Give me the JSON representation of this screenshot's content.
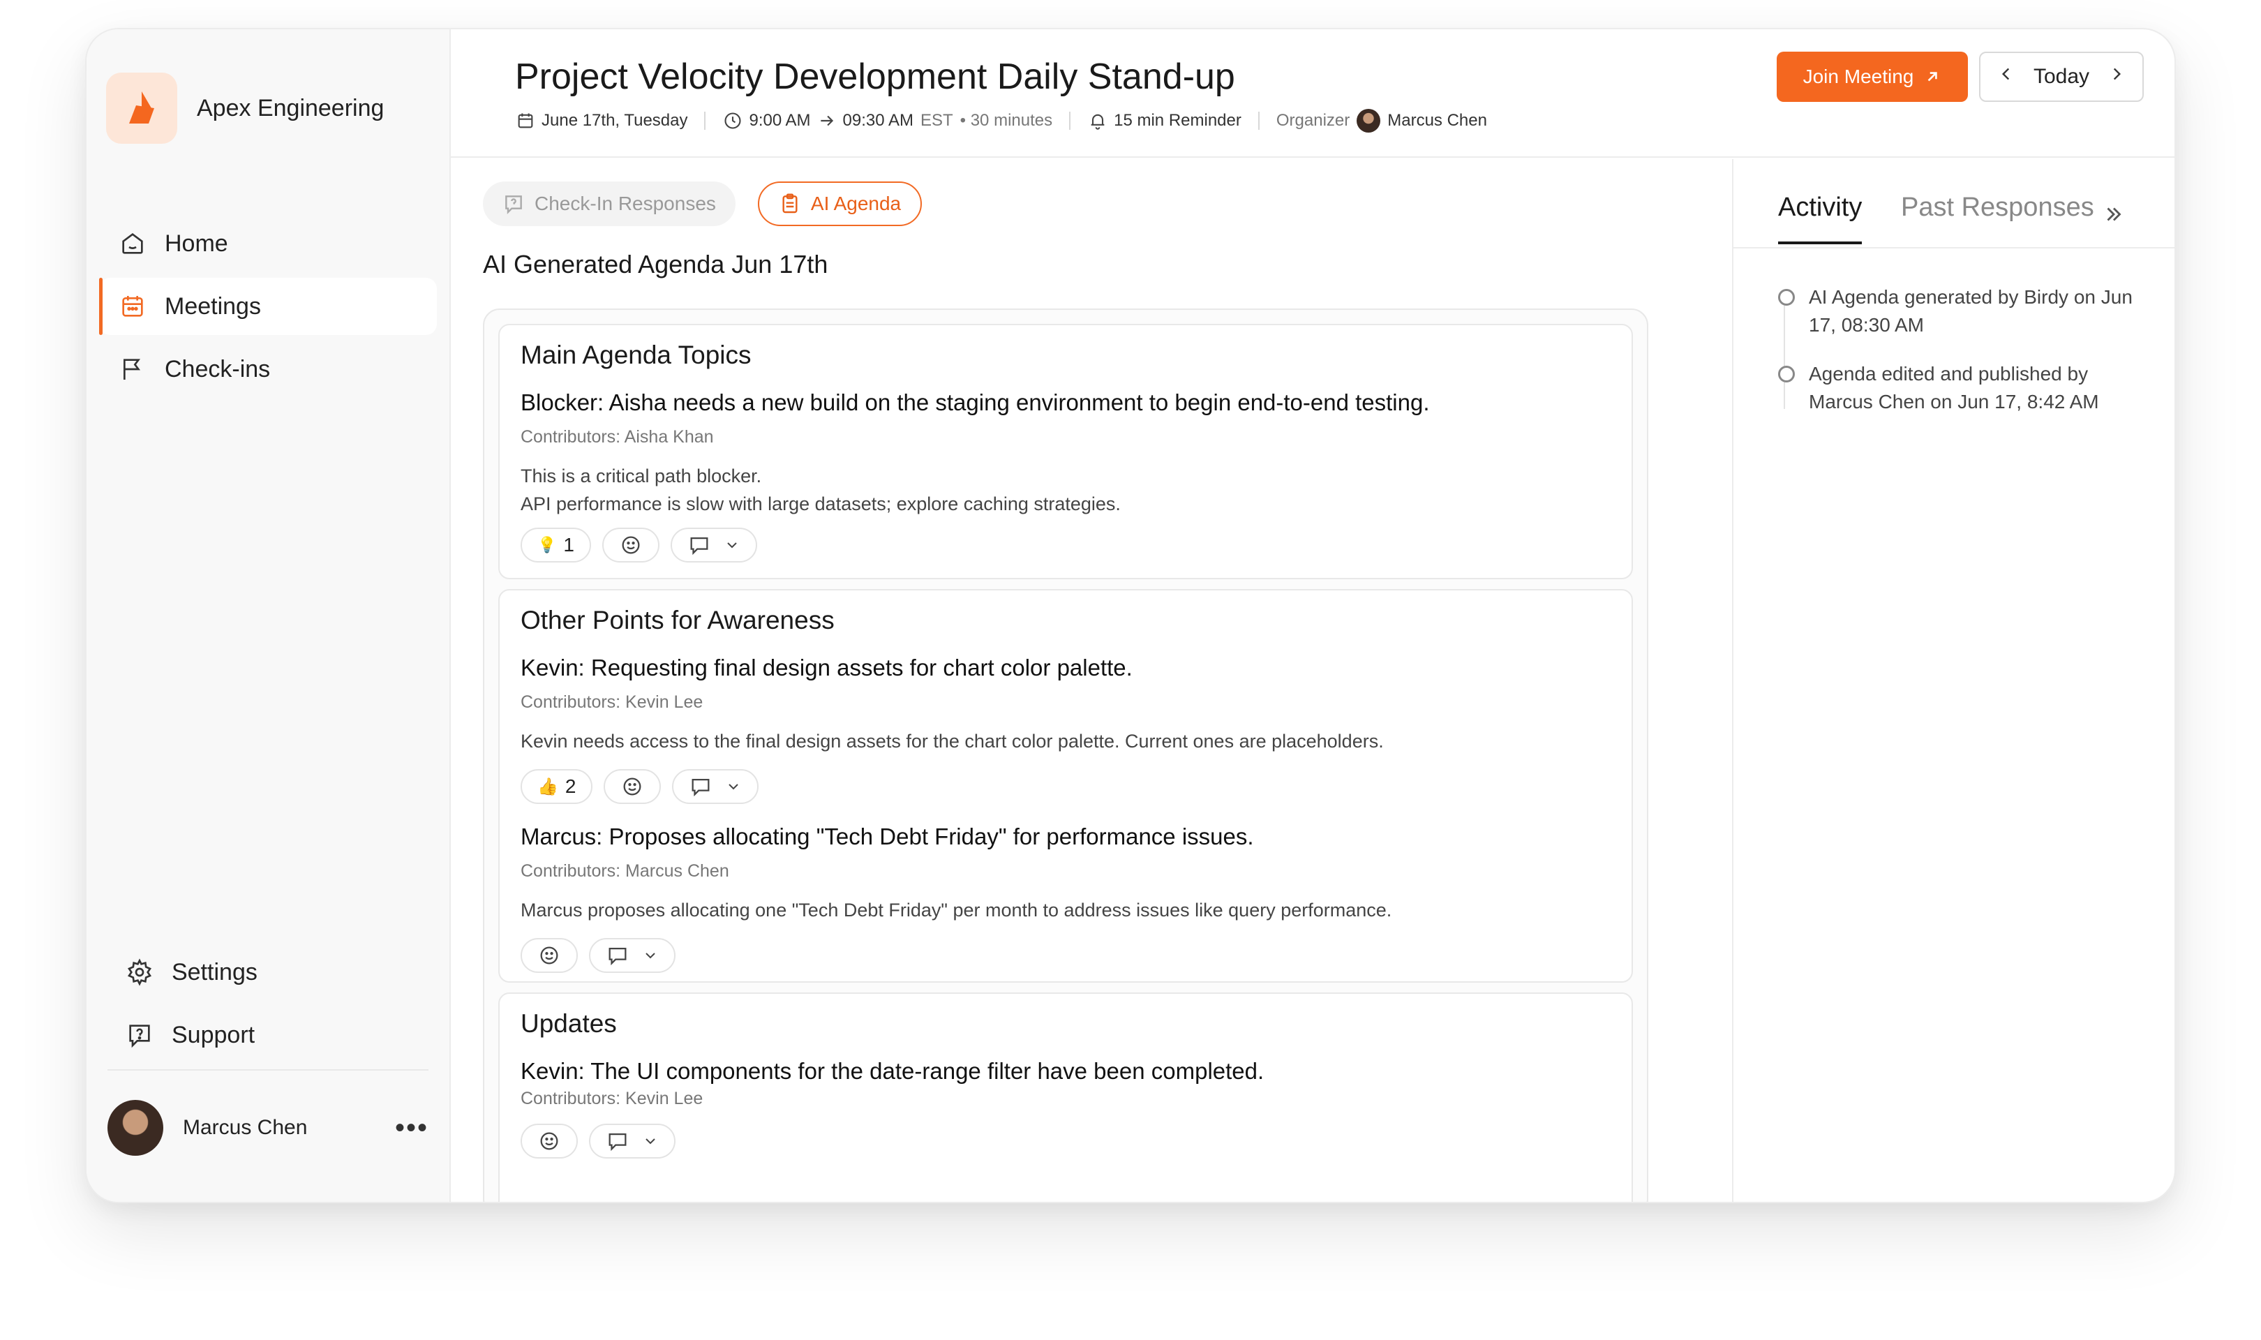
{
  "brand": {
    "name": "Apex Engineering",
    "accent": "#f4671f"
  },
  "nav": {
    "items": [
      {
        "label": "Home",
        "icon": "home-icon"
      },
      {
        "label": "Meetings",
        "icon": "calendar-icon",
        "active": true
      },
      {
        "label": "Check-ins",
        "icon": "flag-icon"
      }
    ],
    "bottom": [
      {
        "label": "Settings",
        "icon": "gear-icon"
      },
      {
        "label": "Support",
        "icon": "help-icon"
      }
    ]
  },
  "user": {
    "name": "Marcus Chen"
  },
  "meeting": {
    "title": "Project Velocity Development Daily Stand-up",
    "date": "June 17th, Tuesday",
    "start": "9:00 AM",
    "end": "09:30 AM",
    "tz": "EST",
    "duration": "• 30 minutes",
    "reminder": "15 min Reminder",
    "organizer_label": "Organizer",
    "organizer": "Marcus Chen"
  },
  "actions": {
    "join": "Join Meeting",
    "today": "Today"
  },
  "tabs": {
    "checkin": "Check-In Responses",
    "agenda": "AI Agenda"
  },
  "agenda": {
    "heading": "AI Generated Agenda  Jun 17th",
    "sections": [
      {
        "title": "Main Agenda Topics",
        "items": [
          {
            "title": "Blocker: Aisha needs a new build on the staging environment to begin end-to-end testing.",
            "contributors": "Contributors: Aisha Khan",
            "desc": [
              "This is a critical path blocker.",
              "API performance is slow with large datasets; explore caching strategies."
            ],
            "reaction": {
              "emoji": "💡",
              "count": "1"
            }
          }
        ]
      },
      {
        "title": "Other Points for Awareness",
        "items": [
          {
            "title": "Kevin: Requesting final design assets for chart color palette.",
            "contributors": "Contributors: Kevin Lee",
            "desc": [
              "Kevin needs access to the final design assets for the chart color palette. Current ones are placeholders."
            ],
            "reaction": {
              "emoji": "👍",
              "count": "2"
            }
          },
          {
            "title": "Marcus: Proposes allocating \"Tech Debt Friday\" for performance issues.",
            "contributors": "Contributors: Marcus Chen",
            "desc": [
              "Marcus proposes allocating one \"Tech Debt Friday\" per month to address issues like query performance."
            ]
          }
        ]
      },
      {
        "title": "Updates",
        "items": [
          {
            "title": "Kevin: The UI components for the date-range filter have been completed.",
            "contributors": "Contributors: Kevin Lee"
          }
        ]
      }
    ]
  },
  "activity": {
    "tab_active": "Activity",
    "tab_inactive": "Past Responses",
    "events": [
      "AI Agenda generated by Birdy on Jun 17, 08:30 AM",
      "Agenda edited and published by Marcus Chen on Jun 17, 8:42 AM"
    ]
  }
}
